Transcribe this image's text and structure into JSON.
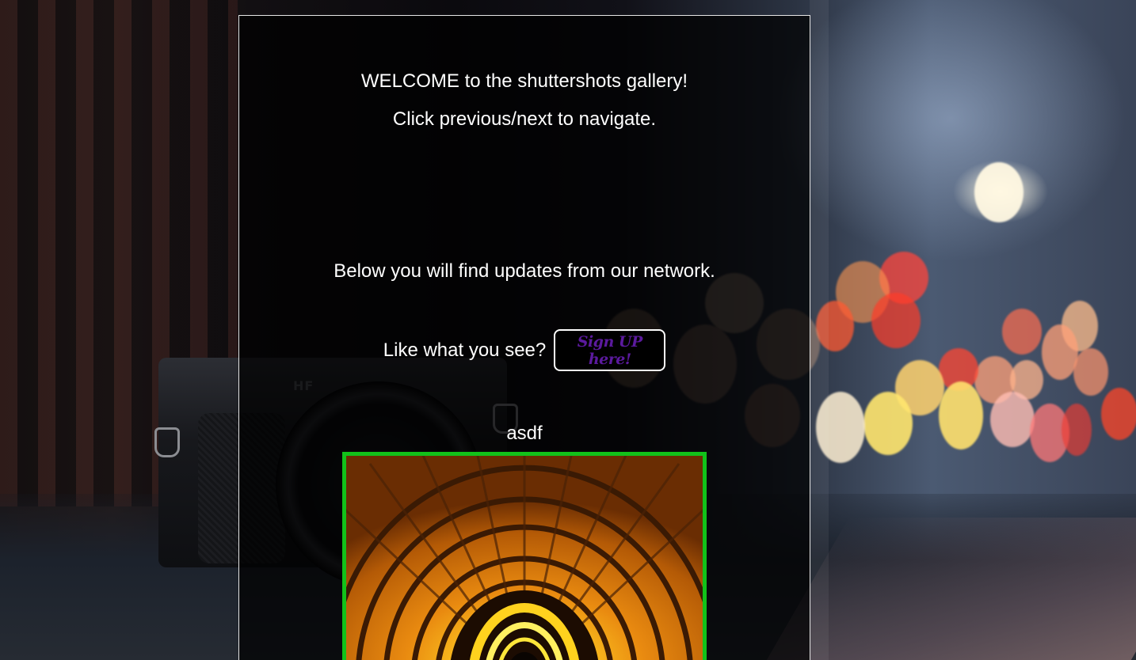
{
  "page": {
    "welcome_text": "WELCOME to the shuttershots gallery!",
    "instruction_text": "Click previous/next to navigate.",
    "updates_text": "Below you will find updates from our network."
  },
  "signup": {
    "prompt": "Like what you see?",
    "button_label": "Sign UP here!"
  },
  "feed": {
    "posts": [
      {
        "title": "asdf",
        "image_description": "orange-arch-tunnel-photo"
      }
    ]
  },
  "background": {
    "camera_brand": "HF"
  },
  "colors": {
    "panel_border": "#e6e6e6",
    "signup_text": "#5b1a9e",
    "post_image_border": "#12c21a",
    "text": "#ffffff"
  }
}
